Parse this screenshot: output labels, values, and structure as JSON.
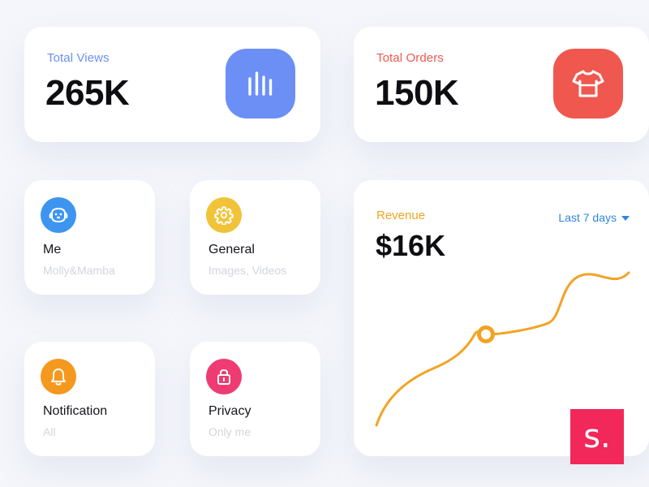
{
  "stats": {
    "views": {
      "label": "Total Views",
      "value": "265K",
      "icon": "bar-chart-icon",
      "accent": "#6c8ff6",
      "label_color": "#6c8ff6"
    },
    "orders": {
      "label": "Total Orders",
      "value": "150K",
      "icon": "tshirt-icon",
      "accent": "#f0584f",
      "label_color": "#f0584f"
    }
  },
  "tiles": [
    {
      "title": "Me",
      "subtitle": "Molly&Mamba",
      "icon": "dog-face-icon",
      "color": "#3d95f0"
    },
    {
      "title": "General",
      "subtitle": "Images, Videos",
      "icon": "gear-icon",
      "color": "#f1c338"
    },
    {
      "title": "Notification",
      "subtitle": "All",
      "icon": "bell-icon",
      "color": "#f5981e"
    },
    {
      "title": "Privacy",
      "subtitle": "Only me",
      "icon": "lock-icon",
      "color": "#ee3c72"
    }
  ],
  "revenue": {
    "label": "Revenue",
    "label_color": "#f2a324",
    "value": "$16K",
    "range": {
      "selected": "Last 7 days",
      "color": "#2f86e0"
    },
    "line_color": "#f2a324",
    "marker_color": "#f2a324"
  },
  "brand": {
    "text": "s.",
    "color": "#f2275a"
  }
}
